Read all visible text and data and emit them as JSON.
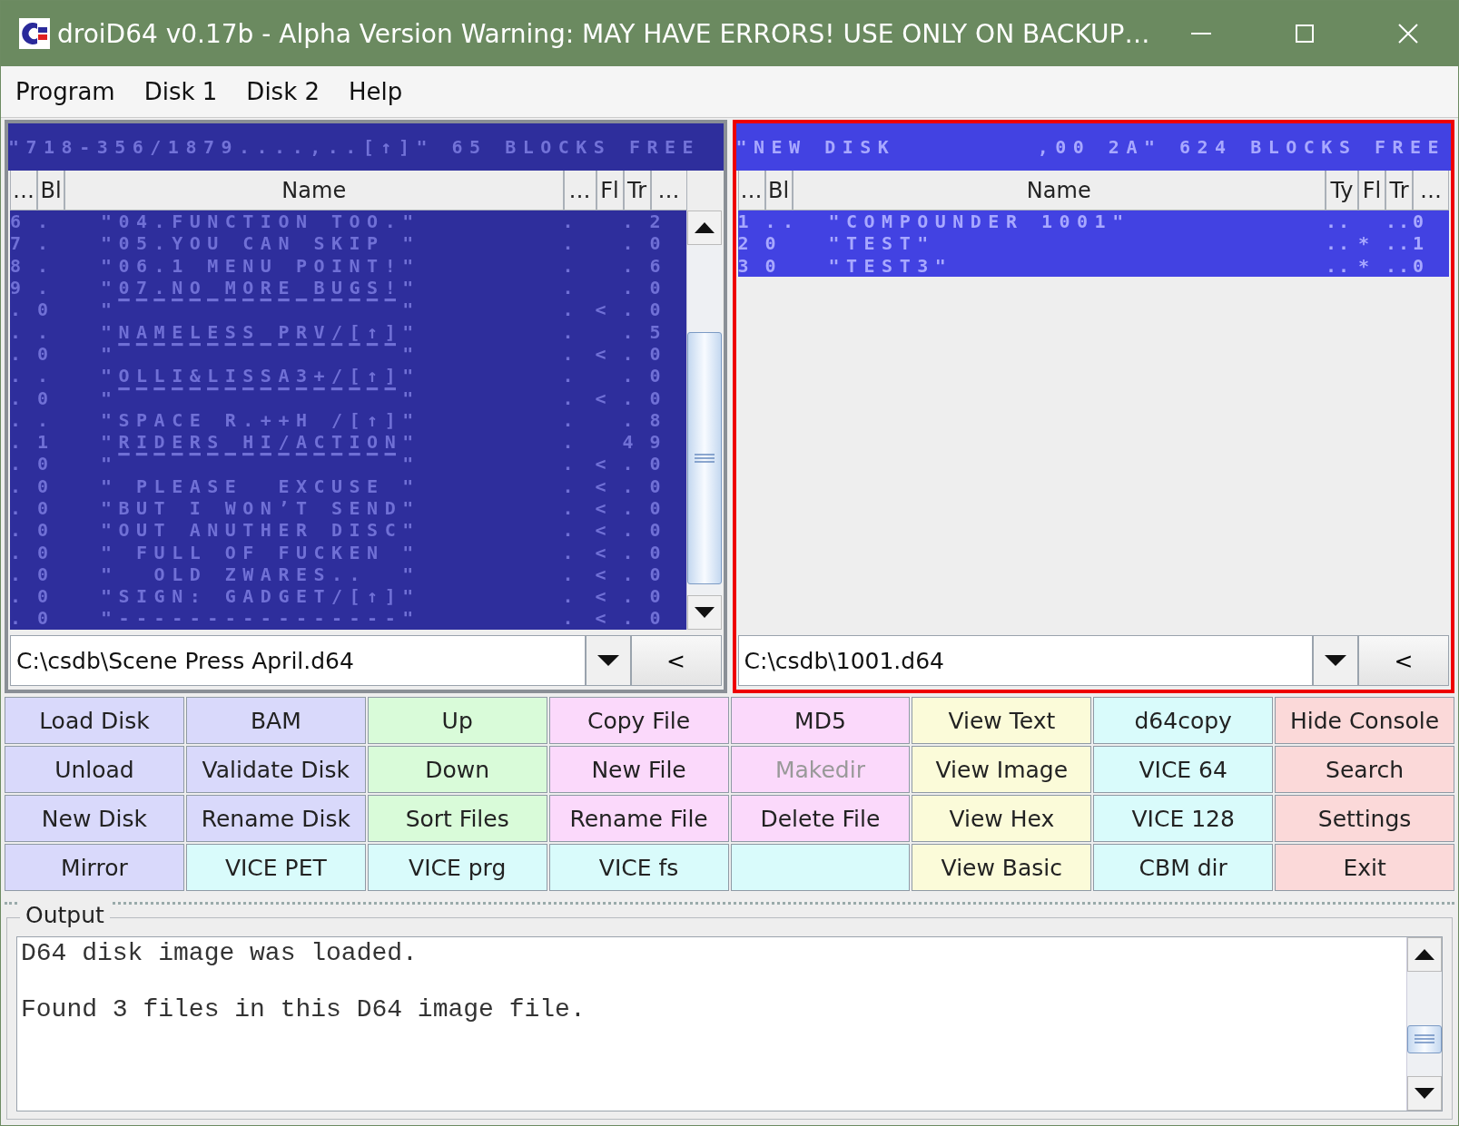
{
  "window": {
    "title": "droiD64 v0.17b - Alpha Version Warning: MAY HAVE ERRORS! USE ONLY ON BACKUP…"
  },
  "menu": [
    {
      "label": "Program"
    },
    {
      "label": "Disk 1"
    },
    {
      "label": "Disk 2"
    },
    {
      "label": "Help"
    }
  ],
  "panels": [
    {
      "active": false,
      "scrollbar": true,
      "disk_header": "\"718-356/1879....,..[↑]\" 65 BLOCKS FREE ",
      "columns": [
        "…",
        "Bl",
        "Name",
        "…",
        "Fl",
        "Tr",
        "…"
      ],
      "rows": [
        {
          "selected": false,
          "cells": [
            "6",
            ".",
            "\"04.FUNCTION TOO.\"",
            ".",
            null,
            ".",
            "2"
          ]
        },
        {
          "selected": false,
          "cells": [
            "7",
            ".",
            "\"05.YOU CAN SKIP \"",
            ".",
            null,
            ".",
            "0"
          ]
        },
        {
          "selected": false,
          "cells": [
            "8",
            ".",
            "\"06.1 MENU POINT!\"",
            ".",
            null,
            ".",
            "6"
          ]
        },
        {
          "selected": false,
          "cells": [
            "9",
            ".",
            "\"07.NO MORE BUGS!\"",
            ".",
            null,
            ".",
            "0"
          ]
        },
        {
          "selected": false,
          "cells": [
            ".",
            "0",
            "\"▔▔▔▔▔▔▔▔▔▔▔▔▔▔▔▔\"",
            ".",
            "<",
            ".",
            "0"
          ]
        },
        {
          "selected": false,
          "cells": [
            ".",
            ".",
            "\"NAMELESS PRV/[↑]\"",
            ".",
            null,
            ".",
            "5"
          ]
        },
        {
          "selected": false,
          "cells": [
            ".",
            "0",
            "\"▔▔▔▔▔▔▔▔▔▔▔▔▔▔▔▔\"",
            ".",
            "<",
            ".",
            "0"
          ]
        },
        {
          "selected": false,
          "cells": [
            ".",
            ".",
            "\"OLLI&LISSA3+/[↑]\"",
            ".",
            null,
            ".",
            "0"
          ]
        },
        {
          "selected": false,
          "cells": [
            ".",
            "0",
            "\"▔▔▔▔▔▔▔▔▔▔▔▔▔▔▔▔\"",
            ".",
            "<",
            ".",
            "0"
          ]
        },
        {
          "selected": false,
          "cells": [
            ".",
            ".",
            "\"SPACE R.++H /[↑]\"",
            ".",
            null,
            ".",
            "8"
          ]
        },
        {
          "selected": false,
          "cells": [
            ".",
            "1",
            "\"RIDERS HI/ACTION\"",
            ".",
            null,
            "4",
            "9"
          ]
        },
        {
          "selected": false,
          "cells": [
            ".",
            "0",
            "\"▔▔▔▔▔▔▔▔▔▔▔▔▔▔▔▔\"",
            ".",
            "<",
            ".",
            "0"
          ]
        },
        {
          "selected": false,
          "cells": [
            ".",
            "0",
            "\" PLEASE  EXCUSE \"",
            ".",
            "<",
            ".",
            "0"
          ]
        },
        {
          "selected": false,
          "cells": [
            ".",
            "0",
            "\"BUT I WON’T SEND\"",
            ".",
            "<",
            ".",
            "0"
          ]
        },
        {
          "selected": false,
          "cells": [
            ".",
            "0",
            "\"OUT ANUTHER DISC\"",
            ".",
            "<",
            ".",
            "0"
          ]
        },
        {
          "selected": false,
          "cells": [
            ".",
            "0",
            "\" FULL OF FUCKEN \"",
            ".",
            "<",
            ".",
            "0"
          ]
        },
        {
          "selected": false,
          "cells": [
            ".",
            "0",
            "\"  OLD ZWARES..  \"",
            ".",
            "<",
            ".",
            "0"
          ]
        },
        {
          "selected": false,
          "cells": [
            ".",
            "0",
            "\"SIGN: GADGET/[↑]\"",
            ".",
            "<",
            ".",
            "0"
          ]
        },
        {
          "selected": false,
          "cells": [
            ".",
            "0",
            "\"----------------\"",
            ".",
            "<",
            ".",
            "0"
          ]
        }
      ],
      "path": "C:\\csdb\\Scene Press April.d64",
      "back_button": "<"
    },
    {
      "active": true,
      "scrollbar": false,
      "disk_header": "\"NEW DISK        ,00 2A\" 624 BLOCKS FREE",
      "columns": [
        "…",
        "Bl",
        "Name",
        "Ty",
        "Fl",
        "Tr",
        "…"
      ],
      "rows": [
        {
          "selected": true,
          "cells": [
            "1",
            "..",
            "\"COMPOUNDER 1001\"",
            "..",
            null,
            "..",
            "0"
          ]
        },
        {
          "selected": true,
          "cells": [
            "2",
            "0",
            "\"TEST\"",
            "..",
            "*",
            "..",
            "1"
          ]
        },
        {
          "selected": true,
          "cells": [
            "3",
            "0",
            "\"TEST3\"",
            "..",
            "*",
            "..",
            "0"
          ]
        }
      ],
      "path": "C:\\csdb\\1001.d64",
      "back_button": "<"
    }
  ],
  "buttons": [
    {
      "label": "Load Disk",
      "color": "#d9d9fb",
      "disabled": false
    },
    {
      "label": "BAM",
      "color": "#d9d9fb",
      "disabled": false
    },
    {
      "label": "Up",
      "color": "#d9fbd9",
      "disabled": false
    },
    {
      "label": "Copy File",
      "color": "#fbd9fb",
      "disabled": false
    },
    {
      "label": "MD5",
      "color": "#fbd9fb",
      "disabled": false
    },
    {
      "label": "View Text",
      "color": "#fbfbd9",
      "disabled": false
    },
    {
      "label": "d64copy",
      "color": "#d9fbfb",
      "disabled": false
    },
    {
      "label": "Hide Console",
      "color": "#fbd9d9",
      "disabled": false
    },
    {
      "label": "Unload",
      "color": "#d9d9fb",
      "disabled": false
    },
    {
      "label": "Validate Disk",
      "color": "#d9d9fb",
      "disabled": false
    },
    {
      "label": "Down",
      "color": "#d9fbd9",
      "disabled": false
    },
    {
      "label": "New File",
      "color": "#fbd9fb",
      "disabled": false
    },
    {
      "label": "Makedir",
      "color": "#fbd9fb",
      "disabled": true
    },
    {
      "label": "View Image",
      "color": "#fbfbd9",
      "disabled": false
    },
    {
      "label": "VICE 64",
      "color": "#d9fbfb",
      "disabled": false
    },
    {
      "label": "Search",
      "color": "#fbd9d9",
      "disabled": false
    },
    {
      "label": "New Disk",
      "color": "#d9d9fb",
      "disabled": false
    },
    {
      "label": "Rename Disk",
      "color": "#d9d9fb",
      "disabled": false
    },
    {
      "label": "Sort Files",
      "color": "#d9fbd9",
      "disabled": false
    },
    {
      "label": "Rename File",
      "color": "#fbd9fb",
      "disabled": false
    },
    {
      "label": "Delete File",
      "color": "#fbd9fb",
      "disabled": false
    },
    {
      "label": "View Hex",
      "color": "#fbfbd9",
      "disabled": false
    },
    {
      "label": "VICE 128",
      "color": "#d9fbfb",
      "disabled": false
    },
    {
      "label": "Settings",
      "color": "#fbd9d9",
      "disabled": false
    },
    {
      "label": "Mirror",
      "color": "#d9d9fb",
      "disabled": false
    },
    {
      "label": "VICE PET",
      "color": "#d9fbfb",
      "disabled": false
    },
    {
      "label": "VICE prg",
      "color": "#d9fbfb",
      "disabled": false
    },
    {
      "label": "VICE fs",
      "color": "#d9fbfb",
      "disabled": false
    },
    {
      "color": "#d9fbfb"
    },
    {
      "label": "View Basic",
      "color": "#fbfbd9",
      "disabled": false
    },
    {
      "label": "CBM dir",
      "color": "#d9fbfb",
      "disabled": false
    },
    {
      "label": "Exit",
      "color": "#fbd9d9",
      "disabled": false
    }
  ],
  "output": {
    "title": "Output",
    "text": "D64 disk image was loaded.\n\nFound 3 files in this D64 image file."
  }
}
